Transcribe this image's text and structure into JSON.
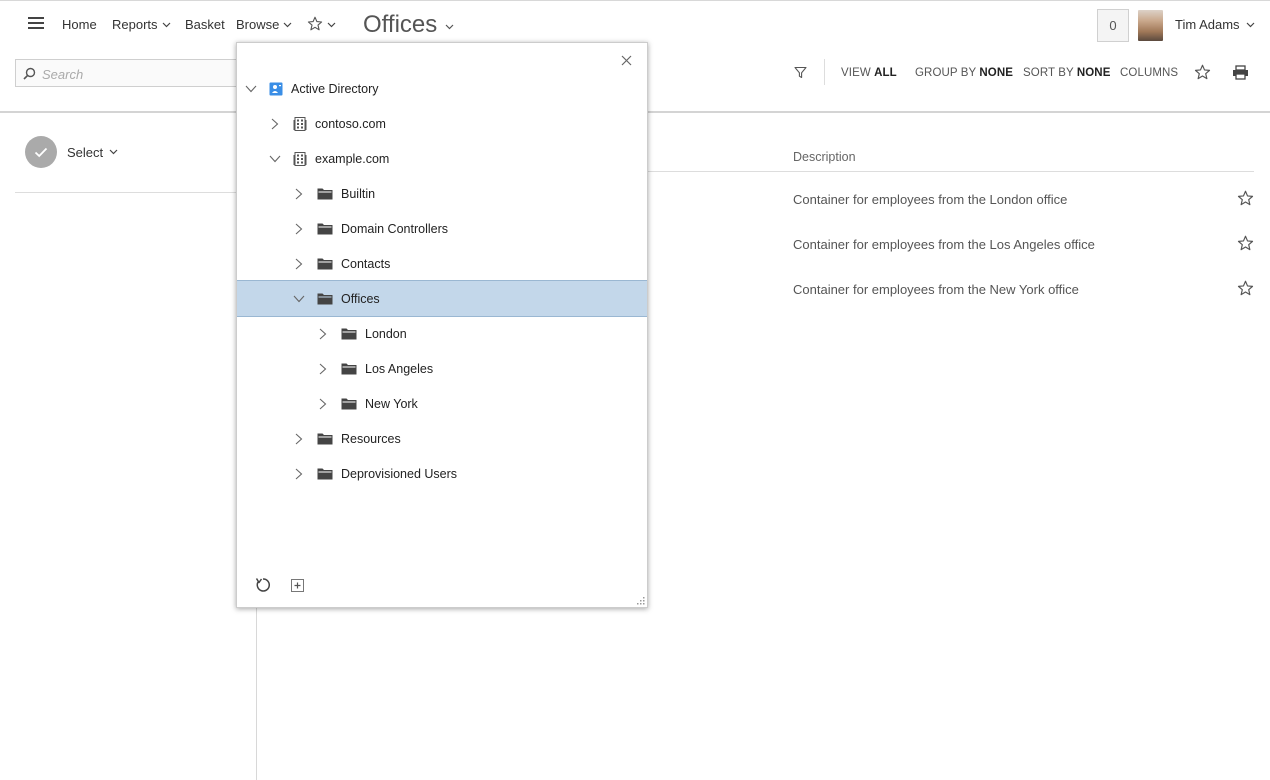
{
  "nav": {
    "home": "Home",
    "reports": "Reports",
    "basket": "Basket",
    "browse": "Browse",
    "page_title": "Offices"
  },
  "user": {
    "basket_count": "0",
    "name": "Tim Adams"
  },
  "toolbar": {
    "search_placeholder": "Search",
    "view_prefix": "VIEW",
    "view_value": "ALL",
    "group_prefix": "GROUP BY",
    "group_value": "NONE",
    "sort_prefix": "SORT BY",
    "sort_value": "NONE",
    "columns": "COLUMNS"
  },
  "left": {
    "select_label": "Select"
  },
  "list": {
    "description_header": "Description",
    "rows": [
      {
        "description": "Container for employees from the London office"
      },
      {
        "description": "Container for employees from the Los Angeles office"
      },
      {
        "description": "Container for employees from the New York office"
      }
    ]
  },
  "tree": {
    "items": [
      {
        "label": "Active Directory",
        "icon": "directory-icon",
        "expanded": true
      },
      {
        "label": "contoso.com",
        "icon": "domain-icon",
        "expanded": false
      },
      {
        "label": "example.com",
        "icon": "domain-icon",
        "expanded": true
      },
      {
        "label": "Builtin",
        "icon": "folder-icon",
        "expanded": false
      },
      {
        "label": "Domain Controllers",
        "icon": "folder-icon",
        "expanded": false
      },
      {
        "label": "Contacts",
        "icon": "folder-icon",
        "expanded": false
      },
      {
        "label": "Offices",
        "icon": "folder-icon",
        "expanded": true,
        "selected": true
      },
      {
        "label": "London",
        "icon": "folder-icon",
        "expanded": false
      },
      {
        "label": "Los Angeles",
        "icon": "folder-icon",
        "expanded": false
      },
      {
        "label": "New York",
        "icon": "folder-icon",
        "expanded": false
      },
      {
        "label": "Resources",
        "icon": "folder-icon",
        "expanded": false
      },
      {
        "label": "Deprovisioned Users",
        "icon": "folder-icon",
        "expanded": false
      }
    ]
  },
  "colors": {
    "selection": "#c3d7ea",
    "directory_blue": "#3a8ee6",
    "select_circle": "#aaaaaa"
  }
}
